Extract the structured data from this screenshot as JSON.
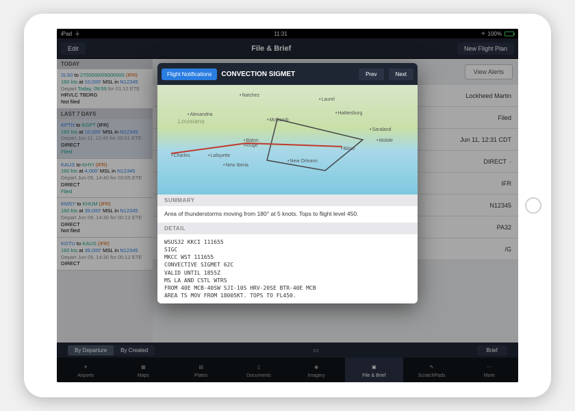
{
  "status": {
    "carrier": "iPad",
    "time": "11:31",
    "battery": "100%"
  },
  "nav": {
    "edit": "Edit",
    "title": "File & Brief",
    "new_plan": "New Flight Plan"
  },
  "sections": {
    "today": "TODAY",
    "last7": "LAST 7 DAYS"
  },
  "flights": [
    {
      "dep": "2LS0",
      "arr": "2700000/09000000",
      "rules": "(IFR)",
      "speed": "160 kts",
      "alt": "10,000'",
      "msl": "MSL",
      "tail": "N12345",
      "depart_prefix": "Depart ",
      "depart_when": "Today, 09:55",
      "ete": " for 01:12 ETE",
      "notes": "HRVLC TBDRG",
      "status": "Not filed"
    },
    {
      "dep": "KPTN",
      "arr": "KGPT",
      "rules": "(IFR)",
      "speed": "160 kts",
      "alt": "10,000'",
      "msl": "MSL",
      "tail": "N12345",
      "depart_prefix": "Depart ",
      "depart_when": "Jun 11, 12:40",
      "ete": " for 00:51 ETE",
      "notes": "DIRECT",
      "status": "Filed"
    },
    {
      "dep": "KAUS",
      "arr": "KHYI",
      "rules": "(IFR)",
      "speed": "160 kts",
      "alt": "4,000'",
      "msl": "MSL",
      "tail": "N12345",
      "depart_prefix": "Depart ",
      "depart_when": "Jun 09, 14:40",
      "ete": " for 03:05 ETE",
      "notes": "DIRECT",
      "status": "Filed"
    },
    {
      "dep": "KMSY",
      "arr": "KHUM",
      "rules": "(IFR)",
      "speed": "160 kts",
      "alt": "39,000'",
      "msl": "MSL",
      "tail": "N12345",
      "depart_prefix": "Depart ",
      "depart_when": "Jun 09, 14:30",
      "ete": " for 00:12 ETE",
      "notes": "DIRECT",
      "status": "Not filed"
    },
    {
      "dep": "KGTU",
      "arr": "KAUS",
      "rules": "(IFR)",
      "speed": "160 kts",
      "alt": "39,000'",
      "msl": "MSL",
      "tail": "N12345",
      "depart_prefix": "Depart ",
      "depart_when": "Jun 09, 14:30",
      "ete": " for 00:12 ETE",
      "notes": "DIRECT",
      "status": ""
    }
  ],
  "right": {
    "view_alerts": "View Alerts",
    "rows": [
      "Lockheed Martin",
      "Filed",
      "Jun 11, 12:31 CDT",
      "DIRECT",
      "IFR",
      "N12345",
      "PA32",
      "/G"
    ]
  },
  "filters": {
    "by_departure": "By Departure",
    "by_created": "By Created",
    "brief": "Brief"
  },
  "tabs": [
    "Airports",
    "Maps",
    "Plates",
    "Documents",
    "Imagery",
    "File & Brief",
    "ScratchPads",
    "More"
  ],
  "modal": {
    "flight_notifications": "Flight Notifications",
    "title": "CONVECTION SIGMET",
    "prev": "Prev",
    "next": "Next",
    "cities": {
      "natchez": "Natchez",
      "laurel": "Laurel",
      "hattiesburg": "Hattiesburg",
      "alexandria": "Alexandria",
      "mccomb": "McComb",
      "saraland": "Saraland",
      "mobile": "Mobile",
      "baton_rouge": "Baton\nRouge",
      "biloxi": "Biloxi",
      "charles": "Charles",
      "lafayette": "Lafayette",
      "new_iberia": "New Iberia",
      "new_orleans": "New Orleans",
      "louisiana": "Louisiana"
    },
    "summary_head": "SUMMARY",
    "summary": "Area of thunderstorms moving from 180° at 5 knots. Tops to flight level 450.",
    "detail_head": "DETAIL",
    "detail": [
      "WSUS32 KKCI 111655",
      "SIGC",
      "MKCC WST 111655",
      "CONVECTIVE SIGMET 62C",
      "VALID UNTIL 1855Z",
      "MS LA AND CSTL WTRS",
      "FROM 40E MCB-40SW SJI-10S HRV-20SE BTR-40E MCB",
      "AREA TS MOV FROM 18005KT. TOPS TO FL450."
    ]
  }
}
